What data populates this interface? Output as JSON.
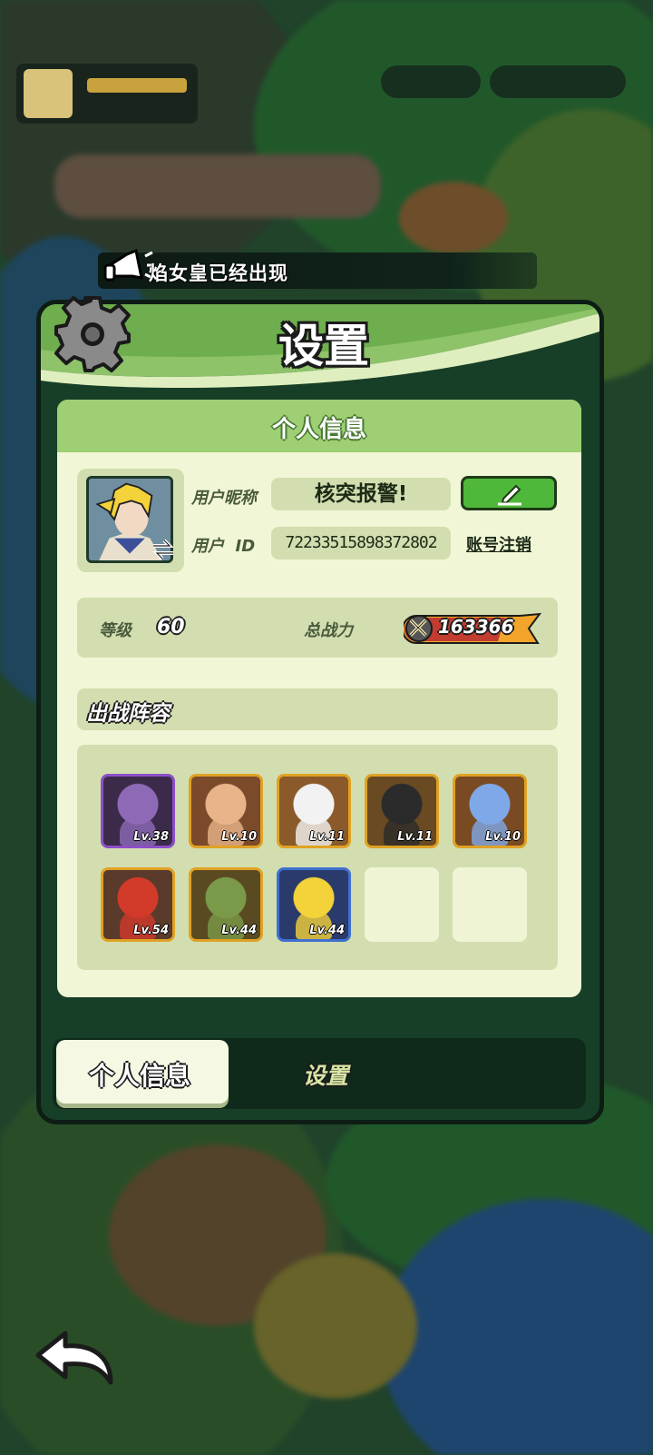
{
  "broadcast": {
    "text": "焰女皇已经出现"
  },
  "dialog": {
    "title": "设置"
  },
  "section_header": "个人信息",
  "profile": {
    "nickname_label": "用户昵称",
    "nickname": "核突报警!",
    "id_label": "用户  ID",
    "id": "72233515898372802",
    "cancel_account_label": "账号注销",
    "level_label": "等级",
    "level": "60",
    "power_label": "总战力",
    "power": "163366"
  },
  "lineup": {
    "title": "出战阵容",
    "heroes": [
      {
        "level": "Lv.38",
        "frame": "#8c4fc9"
      },
      {
        "level": "Lv.10",
        "frame": "#e0a224"
      },
      {
        "level": "Lv.11",
        "frame": "#e0a224"
      },
      {
        "level": "Lv.11",
        "frame": "#e0a224"
      },
      {
        "level": "Lv.10",
        "frame": "#e0a224"
      },
      {
        "level": "Lv.54",
        "frame": "#e0a224"
      },
      {
        "level": "Lv.44",
        "frame": "#e0a224"
      },
      {
        "level": "Lv.44",
        "frame": "#3f6fcf"
      },
      {
        "level": "",
        "frame": "empty"
      },
      {
        "level": "",
        "frame": "empty"
      }
    ]
  },
  "tabs": [
    {
      "label": "个人信息",
      "active": true
    },
    {
      "label": "设置",
      "active": false
    }
  ],
  "colors": {
    "panel_dark": "#173f27",
    "header_green": "#9ecf74",
    "content_bg": "#f1f7d6",
    "edit_button": "#4fb83a"
  }
}
